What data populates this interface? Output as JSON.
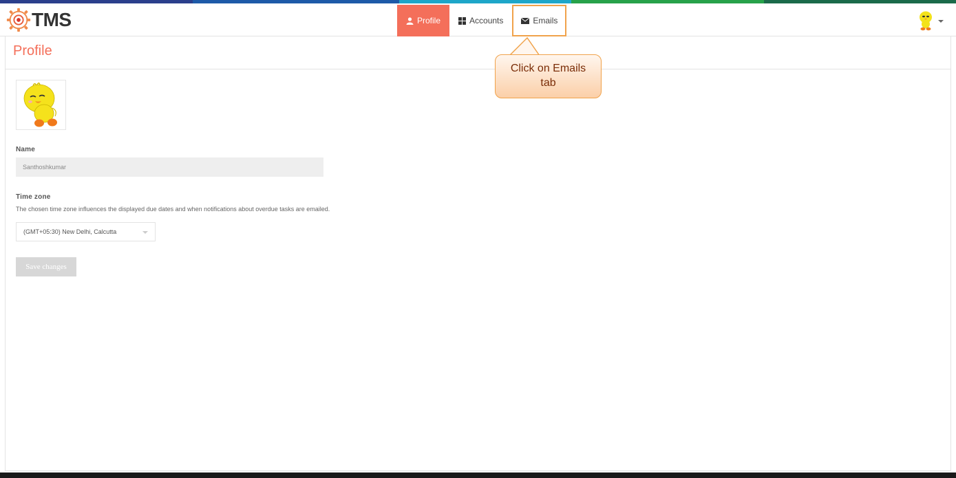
{
  "brand": {
    "name": "TMS",
    "logo_icon": "tms-gear-logo"
  },
  "colors": {
    "accent": "#f46f5a",
    "callout_border": "#f0a24a",
    "callout_text": "#7a2d08"
  },
  "nav": {
    "tabs": [
      {
        "label": "Profile",
        "icon": "user-icon",
        "active": true
      },
      {
        "label": "Accounts",
        "icon": "grid-icon",
        "active": false
      },
      {
        "label": "Emails",
        "icon": "envelope-icon",
        "active": false
      }
    ]
  },
  "user_menu": {
    "avatar_icon": "tweety-avatar"
  },
  "page": {
    "title": "Profile"
  },
  "form": {
    "name_label": "Name",
    "name_value": "Santhoshkumar",
    "timezone_label": "Time zone",
    "timezone_help": "The chosen time zone influences the displayed due dates and when notifications about overdue tasks are emailed.",
    "timezone_value": "(GMT+05:30) New Delhi, Calcutta",
    "save_label": "Save changes"
  },
  "callout": {
    "line1": "Click on Emails",
    "line2": "tab"
  }
}
